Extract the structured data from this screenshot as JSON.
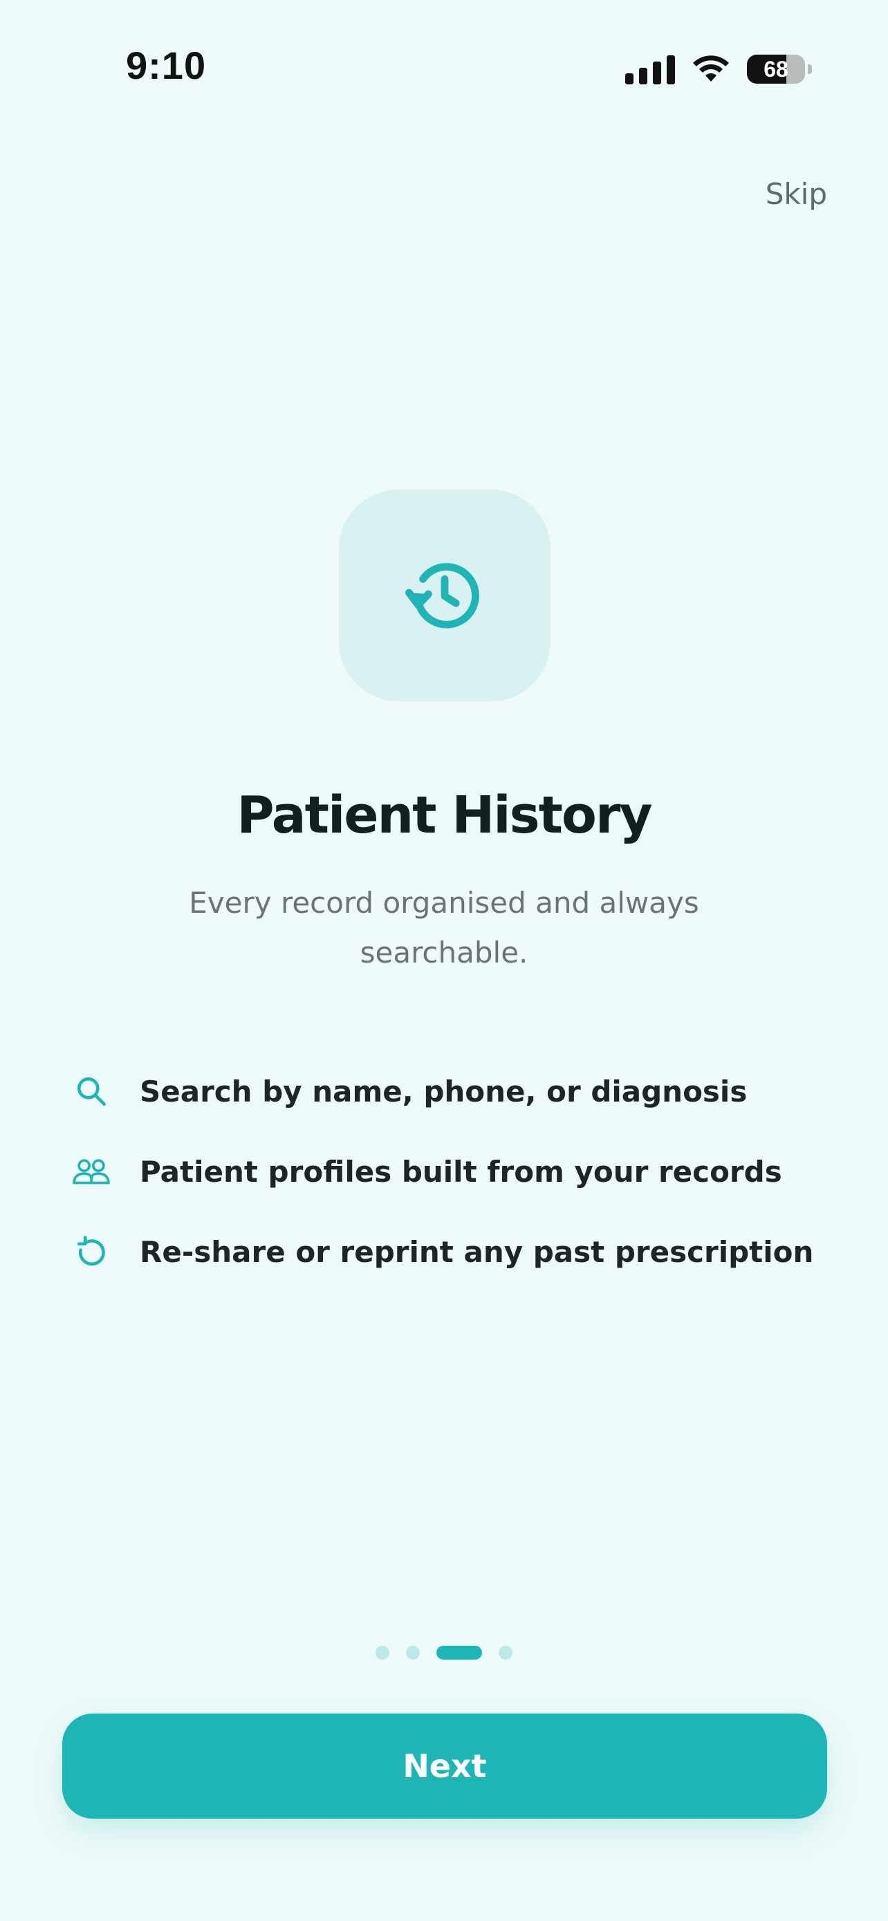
{
  "status_bar": {
    "time": "9:10",
    "battery_percent": "68",
    "battery_level": 0.68
  },
  "header": {
    "skip_label": "Skip"
  },
  "hero": {
    "icon": "history-clock-icon",
    "title": "Patient History",
    "subtitle": "Every record organised and always searchable."
  },
  "features": [
    {
      "icon": "search-icon",
      "text": "Search by name, phone, or diagnosis"
    },
    {
      "icon": "users-icon",
      "text": "Patient profiles built from your records"
    },
    {
      "icon": "rotate-ccw-icon",
      "text": "Re-share or reprint any past prescription"
    }
  ],
  "pagination": {
    "total": 4,
    "current": 3
  },
  "footer": {
    "next_label": "Next"
  },
  "colors": {
    "accent": "#1eb5b7",
    "background": "#eefaf9",
    "tile": "#d9f1f1"
  }
}
